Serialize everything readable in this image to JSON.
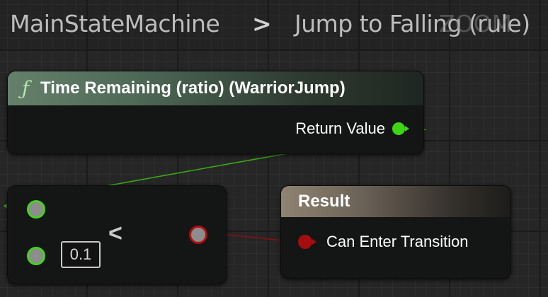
{
  "breadcrumb": {
    "parent": "MainStateMachine",
    "separator": ">",
    "current": "Jump to Falling (rule)",
    "watermark": "ZOOM"
  },
  "nodes": {
    "function_node": {
      "icon": "function-icon",
      "icon_glyph": "ƒ",
      "title": "Time Remaining (ratio) (WarriorJump)",
      "output_pin_label": "Return Value"
    },
    "compare_node": {
      "operator": "<",
      "input_b_value": "0.1"
    },
    "result_node": {
      "title": "Result",
      "input_pin_label": "Can Enter Transition"
    }
  },
  "colors": {
    "float_pin": "#3ed614",
    "bool_pin": "#a50e0e",
    "function_header": "#65806a",
    "result_header": "#8f8372"
  }
}
